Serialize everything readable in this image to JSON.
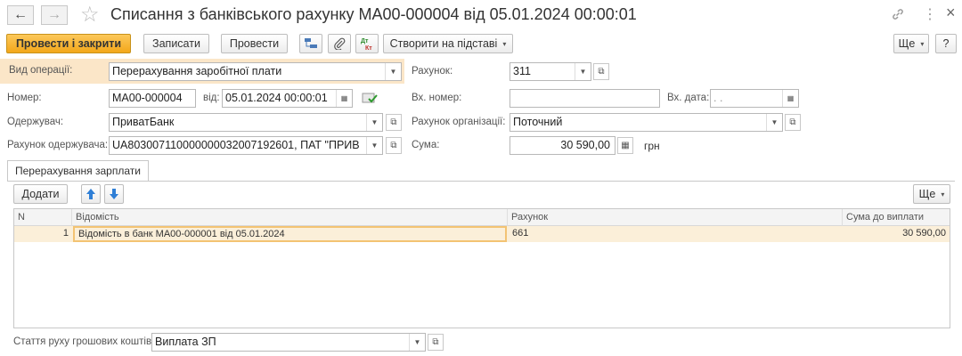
{
  "window": {
    "title": "Списання з банківського рахунку МА00-000004 від 05.01.2024 00:00:01",
    "back_label": "←",
    "forward_label": "→",
    "star_label": "☆",
    "link_label": "🔗",
    "more_label": "⋮",
    "close_label": "×"
  },
  "toolbar": {
    "post_close": "Провести і закрити",
    "save": "Записати",
    "post": "Провести",
    "create_based": "Створити на підставі",
    "more": "Ще",
    "help": "?"
  },
  "form": {
    "operation_label": "Вид операції:",
    "operation_value": "Перерахування заробітної плати",
    "account_label": "Рахунок:",
    "account_value": "311",
    "number_label": "Номер:",
    "number_value": "МА00-000004",
    "from_label": "від:",
    "date_value": "05.01.2024 00:00:01",
    "in_number_label": "Вх. номер:",
    "in_number_value": "",
    "in_date_label": "Вх. дата:",
    "in_date_value": "  .  .",
    "recipient_label": "Одержувач:",
    "recipient_value": "ПриватБанк",
    "org_account_label": "Рахунок організації:",
    "org_account_value": "Поточний",
    "recipient_account_label": "Рахунок одержувача:",
    "recipient_account_value": "UA803007110000000032007192601, ПАТ \"ПРИВ",
    "sum_label": "Сума:",
    "sum_value": "30 590,00",
    "currency": "грн"
  },
  "tab": {
    "label": "Перерахування зарплати",
    "add_button": "Додати",
    "more": "Ще"
  },
  "table": {
    "columns": [
      "N",
      "Відомість",
      "Рахунок",
      "Сума до виплати"
    ],
    "rows": [
      {
        "n": "1",
        "statement": "Відомість в банк МА00-000001 від 05.01.2024",
        "account": "661",
        "amount": "30 590,00"
      }
    ]
  },
  "footer": {
    "cashflow_label": "Стаття руху грошових коштів:",
    "cashflow_value": "Виплата ЗП"
  },
  "colors": {
    "accent": "#f3a71a",
    "row_highlight": "#fbefd9",
    "operation_bg": "#fbe6c8"
  }
}
